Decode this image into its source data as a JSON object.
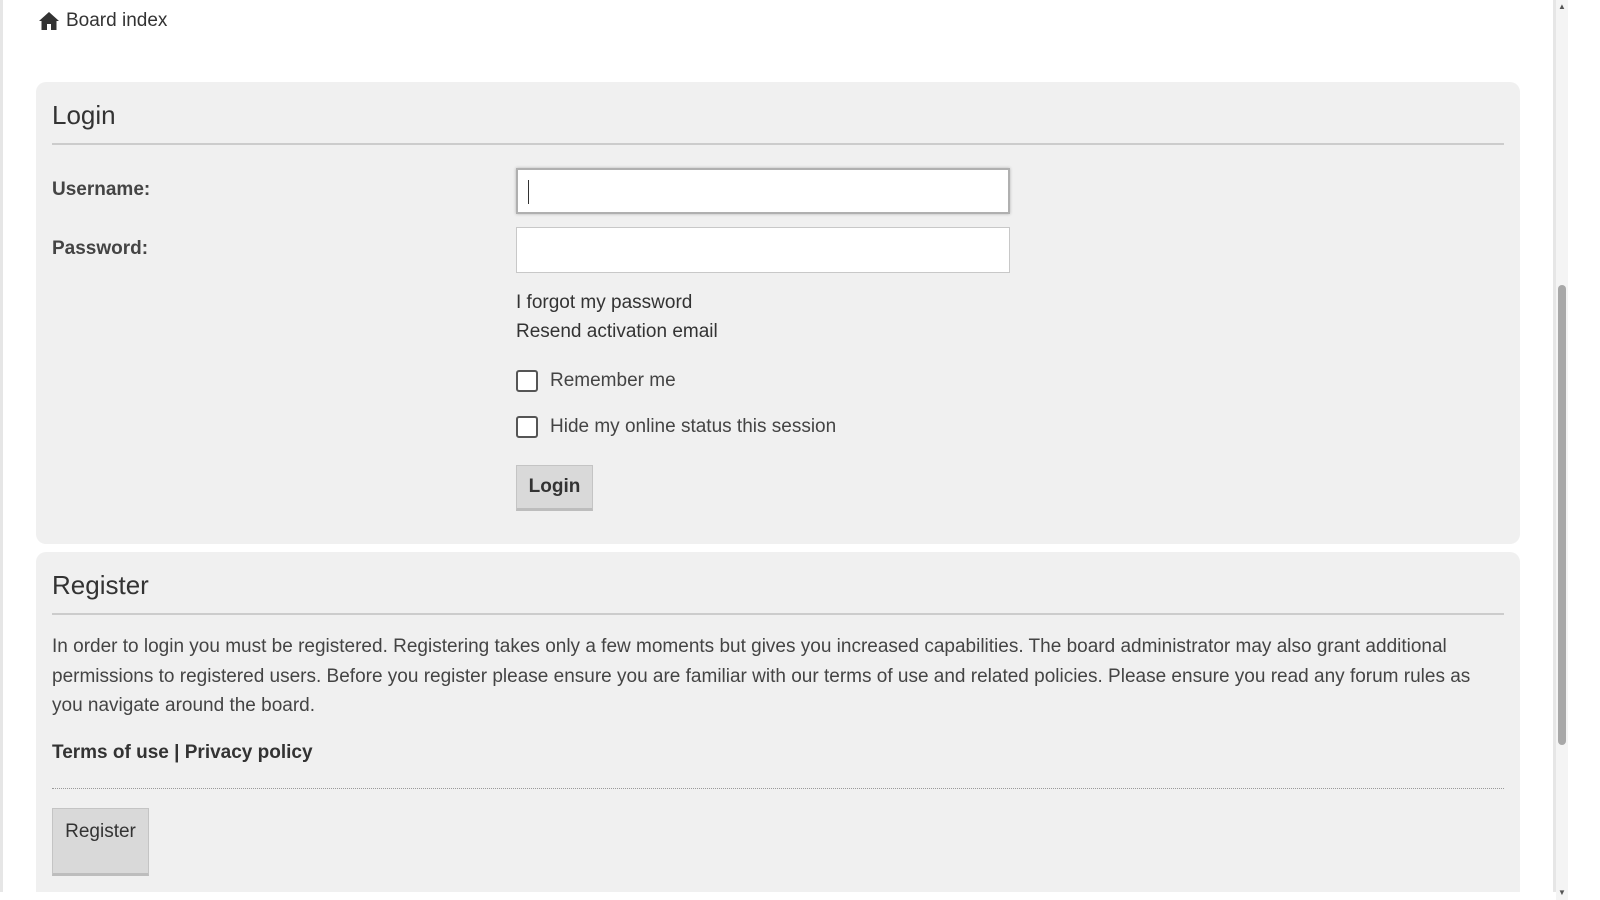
{
  "breadcrumb": {
    "icon": "home-icon",
    "label": "Board index"
  },
  "login_panel": {
    "title": "Login",
    "username_label": "Username:",
    "username_value": "",
    "password_label": "Password:",
    "password_value": "",
    "forgot_password": "I forgot my password",
    "resend_activation": "Resend activation email",
    "remember_me_label": "Remember me",
    "remember_me_checked": false,
    "hide_status_label": "Hide my online status this session",
    "hide_status_checked": false,
    "login_button": "Login"
  },
  "register_panel": {
    "title": "Register",
    "description": "In order to login you must be registered. Registering takes only a few moments but gives you increased capabilities. The board administrator may also grant additional permissions to registered users. Before you register please ensure you are familiar with our terms of use and related policies. Please ensure you read any forum rules as you navigate around the board.",
    "terms_link": "Terms of use",
    "separator": "|",
    "privacy_link": "Privacy policy",
    "register_button": "Register"
  },
  "colors": {
    "panel_bg": "#f0f0f0",
    "button_bg": "#d9d9d9",
    "text": "#333333"
  }
}
